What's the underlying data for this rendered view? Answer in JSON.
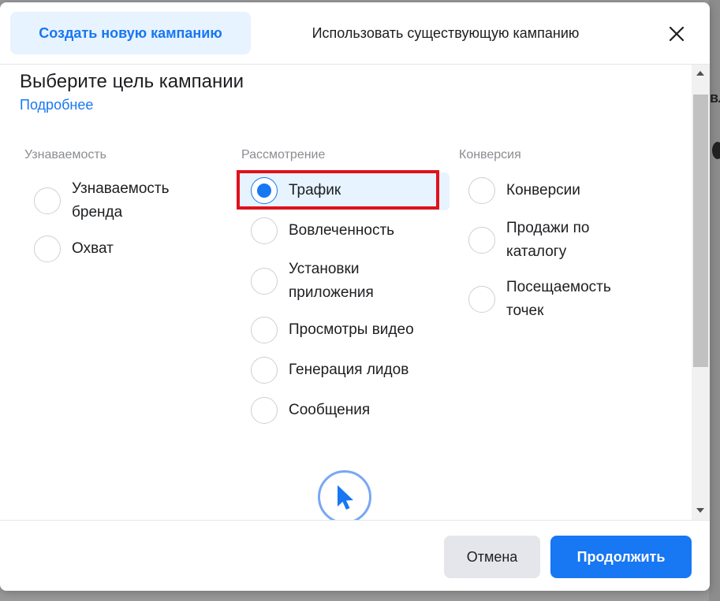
{
  "tabs": {
    "create_new": "Создать новую кампанию",
    "use_existing": "Использовать существующую кампанию"
  },
  "content": {
    "title": "Выберите цель кампании",
    "learn_more": "Подробнее"
  },
  "columns": [
    {
      "header": "Узнаваемость",
      "options": [
        {
          "label": "Узнаваемость бренда",
          "selected": false
        },
        {
          "label": "Охват",
          "selected": false
        }
      ]
    },
    {
      "header": "Рассмотрение",
      "options": [
        {
          "label": "Трафик",
          "selected": true
        },
        {
          "label": "Вовлеченность",
          "selected": false
        },
        {
          "label": "Установки приложения",
          "selected": false
        },
        {
          "label": "Просмотры видео",
          "selected": false
        },
        {
          "label": "Генерация лидов",
          "selected": false
        },
        {
          "label": "Сообщения",
          "selected": false
        }
      ]
    },
    {
      "header": "Конверсия",
      "options": [
        {
          "label": "Конверсии",
          "selected": false
        },
        {
          "label": "Продажи по каталогу",
          "selected": false
        },
        {
          "label": "Посещаемость точек",
          "selected": false
        }
      ]
    }
  ],
  "footer": {
    "cancel": "Отмена",
    "continue": "Продолжить"
  },
  "colors": {
    "accent": "#1877f2",
    "highlight": "#e0111b",
    "selected_bg": "#e7f3ff"
  },
  "icons": {
    "close": "close-icon",
    "cursor": "cursor-arrow-icon"
  }
}
